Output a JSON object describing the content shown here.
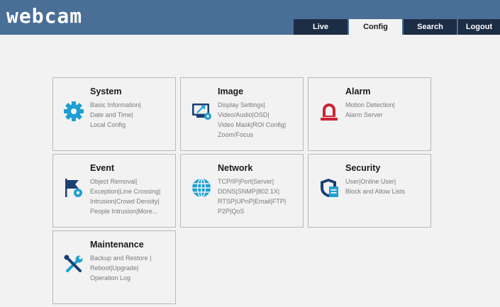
{
  "app": {
    "logo": "webcam"
  },
  "tabs": [
    {
      "label": "Live"
    },
    {
      "label": "Config"
    },
    {
      "label": "Search"
    },
    {
      "label": "Logout"
    }
  ],
  "colors": {
    "header_bg": "#4a6f97",
    "tab_bg": "#1c2d46",
    "icon_blue": "#1ea0d2",
    "icon_red": "#cc2233",
    "icon_navy": "#1a3f73"
  },
  "cards": [
    {
      "title": "System",
      "icon": "gear-icon",
      "links": [
        [
          "Basic Information",
          "|"
        ],
        [
          "Date and Time",
          "|"
        ],
        [
          "Local Config",
          ""
        ]
      ]
    },
    {
      "title": "Image",
      "icon": "display-settings-icon",
      "links": [
        [
          "Display Settings",
          "|"
        ],
        [
          "Video/Audio",
          "|"
        ],
        [
          "OSD",
          "|"
        ],
        [
          "Video Mask",
          "|"
        ],
        [
          "ROI Config",
          "|"
        ],
        [
          "Zoom/Focus",
          ""
        ]
      ]
    },
    {
      "title": "Alarm",
      "icon": "alarm-light-icon",
      "links": [
        [
          "Motion Detection",
          "|"
        ],
        [
          "Alarm Server",
          ""
        ]
      ]
    },
    {
      "title": "Event",
      "icon": "event-flag-icon",
      "links": [
        [
          "Object Removal",
          "|"
        ],
        [
          "Exception",
          "|"
        ],
        [
          "Line Crossing",
          "|"
        ],
        [
          "Intrusion",
          "|"
        ],
        [
          "Crowd Density",
          "|"
        ],
        [
          "People Intrusion",
          "|"
        ],
        [
          "More...",
          ""
        ]
      ]
    },
    {
      "title": "Network",
      "icon": "globe-icon",
      "links": [
        [
          "TCP/IP",
          "|"
        ],
        [
          "Port",
          "|"
        ],
        [
          "Server",
          "|"
        ],
        [
          "DDNS",
          "|"
        ],
        [
          "SNMP",
          "|"
        ],
        [
          "802.1X",
          "|"
        ],
        [
          "RTSP",
          "|"
        ],
        [
          "UPnP",
          "|"
        ],
        [
          "Email",
          "|"
        ],
        [
          "FTP",
          "|"
        ],
        [
          "P2P",
          "|"
        ],
        [
          "QoS",
          ""
        ]
      ]
    },
    {
      "title": "Security",
      "icon": "security-shield-icon",
      "links": [
        [
          "User",
          "|"
        ],
        [
          "Online User",
          "|"
        ],
        [
          "Block and Allow Lists",
          ""
        ]
      ]
    },
    {
      "title": "Maintenance",
      "icon": "tools-icon",
      "links": [
        [
          "Backup and Restore",
          " |"
        ],
        [
          "Reboot",
          "|"
        ],
        [
          "Upgrade",
          "|"
        ],
        [
          "Operation Log",
          ""
        ]
      ]
    }
  ]
}
